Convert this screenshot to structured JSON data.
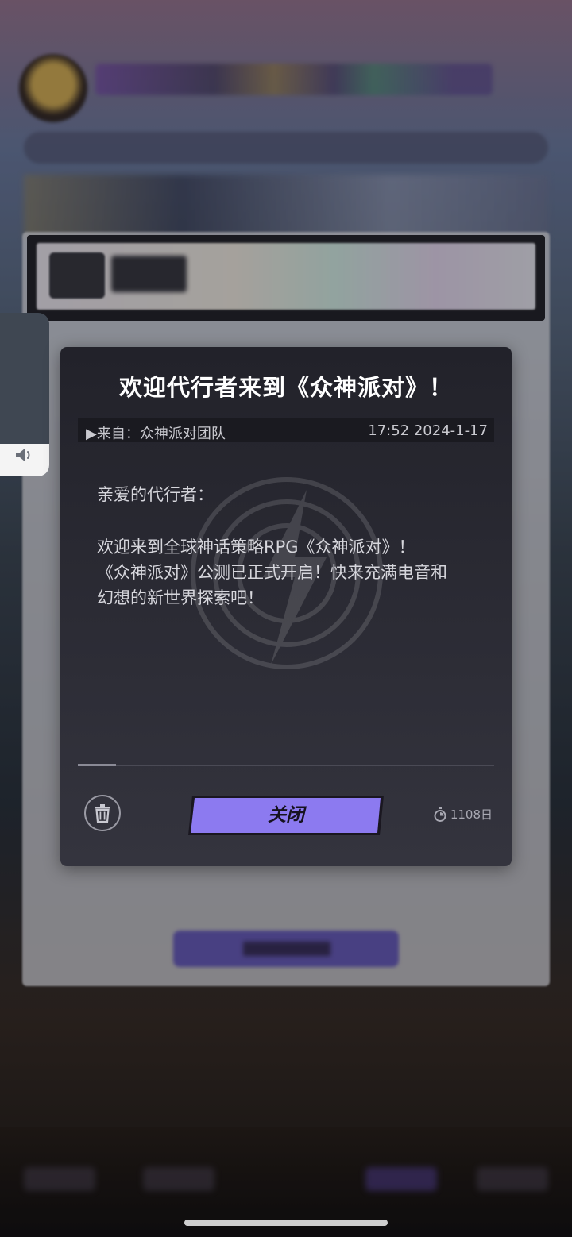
{
  "dialog": {
    "title": "欢迎代行者来到《众神派对》！",
    "from_label": "▶来自：众神派对团队",
    "timestamp": "17:52 2024-1-17",
    "body": {
      "greeting": "亲爱的代行者：",
      "lines": [
        "欢迎来到全球神话策略RPG《众神派对》！",
        "《众神派对》公测已正式开启！快来充满电音和",
        "幻想的新世界探索吧！"
      ]
    },
    "close_button_label": "关闭",
    "expire_text": "1108日",
    "icons": {
      "delete": "trash-icon",
      "expire": "timer-icon",
      "volume": "speaker-icon"
    }
  },
  "volume": {
    "level": 0.2
  },
  "colors": {
    "accent_purple": "#8c7af0",
    "dialog_bg": "#2a2a33",
    "text_primary": "#ffffff",
    "text_secondary": "#d6d6dc"
  }
}
